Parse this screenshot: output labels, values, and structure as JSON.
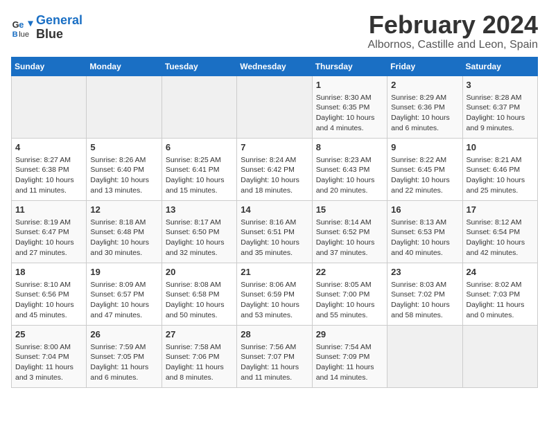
{
  "logo": {
    "line1": "General",
    "line2": "Blue"
  },
  "title": "February 2024",
  "location": "Albornos, Castille and Leon, Spain",
  "days_of_week": [
    "Sunday",
    "Monday",
    "Tuesday",
    "Wednesday",
    "Thursday",
    "Friday",
    "Saturday"
  ],
  "weeks": [
    [
      {
        "day": "",
        "content": ""
      },
      {
        "day": "",
        "content": ""
      },
      {
        "day": "",
        "content": ""
      },
      {
        "day": "",
        "content": ""
      },
      {
        "day": "1",
        "content": "Sunrise: 8:30 AM\nSunset: 6:35 PM\nDaylight: 10 hours\nand 4 minutes."
      },
      {
        "day": "2",
        "content": "Sunrise: 8:29 AM\nSunset: 6:36 PM\nDaylight: 10 hours\nand 6 minutes."
      },
      {
        "day": "3",
        "content": "Sunrise: 8:28 AM\nSunset: 6:37 PM\nDaylight: 10 hours\nand 9 minutes."
      }
    ],
    [
      {
        "day": "4",
        "content": "Sunrise: 8:27 AM\nSunset: 6:38 PM\nDaylight: 10 hours\nand 11 minutes."
      },
      {
        "day": "5",
        "content": "Sunrise: 8:26 AM\nSunset: 6:40 PM\nDaylight: 10 hours\nand 13 minutes."
      },
      {
        "day": "6",
        "content": "Sunrise: 8:25 AM\nSunset: 6:41 PM\nDaylight: 10 hours\nand 15 minutes."
      },
      {
        "day": "7",
        "content": "Sunrise: 8:24 AM\nSunset: 6:42 PM\nDaylight: 10 hours\nand 18 minutes."
      },
      {
        "day": "8",
        "content": "Sunrise: 8:23 AM\nSunset: 6:43 PM\nDaylight: 10 hours\nand 20 minutes."
      },
      {
        "day": "9",
        "content": "Sunrise: 8:22 AM\nSunset: 6:45 PM\nDaylight: 10 hours\nand 22 minutes."
      },
      {
        "day": "10",
        "content": "Sunrise: 8:21 AM\nSunset: 6:46 PM\nDaylight: 10 hours\nand 25 minutes."
      }
    ],
    [
      {
        "day": "11",
        "content": "Sunrise: 8:19 AM\nSunset: 6:47 PM\nDaylight: 10 hours\nand 27 minutes."
      },
      {
        "day": "12",
        "content": "Sunrise: 8:18 AM\nSunset: 6:48 PM\nDaylight: 10 hours\nand 30 minutes."
      },
      {
        "day": "13",
        "content": "Sunrise: 8:17 AM\nSunset: 6:50 PM\nDaylight: 10 hours\nand 32 minutes."
      },
      {
        "day": "14",
        "content": "Sunrise: 8:16 AM\nSunset: 6:51 PM\nDaylight: 10 hours\nand 35 minutes."
      },
      {
        "day": "15",
        "content": "Sunrise: 8:14 AM\nSunset: 6:52 PM\nDaylight: 10 hours\nand 37 minutes."
      },
      {
        "day": "16",
        "content": "Sunrise: 8:13 AM\nSunset: 6:53 PM\nDaylight: 10 hours\nand 40 minutes."
      },
      {
        "day": "17",
        "content": "Sunrise: 8:12 AM\nSunset: 6:54 PM\nDaylight: 10 hours\nand 42 minutes."
      }
    ],
    [
      {
        "day": "18",
        "content": "Sunrise: 8:10 AM\nSunset: 6:56 PM\nDaylight: 10 hours\nand 45 minutes."
      },
      {
        "day": "19",
        "content": "Sunrise: 8:09 AM\nSunset: 6:57 PM\nDaylight: 10 hours\nand 47 minutes."
      },
      {
        "day": "20",
        "content": "Sunrise: 8:08 AM\nSunset: 6:58 PM\nDaylight: 10 hours\nand 50 minutes."
      },
      {
        "day": "21",
        "content": "Sunrise: 8:06 AM\nSunset: 6:59 PM\nDaylight: 10 hours\nand 53 minutes."
      },
      {
        "day": "22",
        "content": "Sunrise: 8:05 AM\nSunset: 7:00 PM\nDaylight: 10 hours\nand 55 minutes."
      },
      {
        "day": "23",
        "content": "Sunrise: 8:03 AM\nSunset: 7:02 PM\nDaylight: 10 hours\nand 58 minutes."
      },
      {
        "day": "24",
        "content": "Sunrise: 8:02 AM\nSunset: 7:03 PM\nDaylight: 11 hours\nand 0 minutes."
      }
    ],
    [
      {
        "day": "25",
        "content": "Sunrise: 8:00 AM\nSunset: 7:04 PM\nDaylight: 11 hours\nand 3 minutes."
      },
      {
        "day": "26",
        "content": "Sunrise: 7:59 AM\nSunset: 7:05 PM\nDaylight: 11 hours\nand 6 minutes."
      },
      {
        "day": "27",
        "content": "Sunrise: 7:58 AM\nSunset: 7:06 PM\nDaylight: 11 hours\nand 8 minutes."
      },
      {
        "day": "28",
        "content": "Sunrise: 7:56 AM\nSunset: 7:07 PM\nDaylight: 11 hours\nand 11 minutes."
      },
      {
        "day": "29",
        "content": "Sunrise: 7:54 AM\nSunset: 7:09 PM\nDaylight: 11 hours\nand 14 minutes."
      },
      {
        "day": "",
        "content": ""
      },
      {
        "day": "",
        "content": ""
      }
    ]
  ]
}
